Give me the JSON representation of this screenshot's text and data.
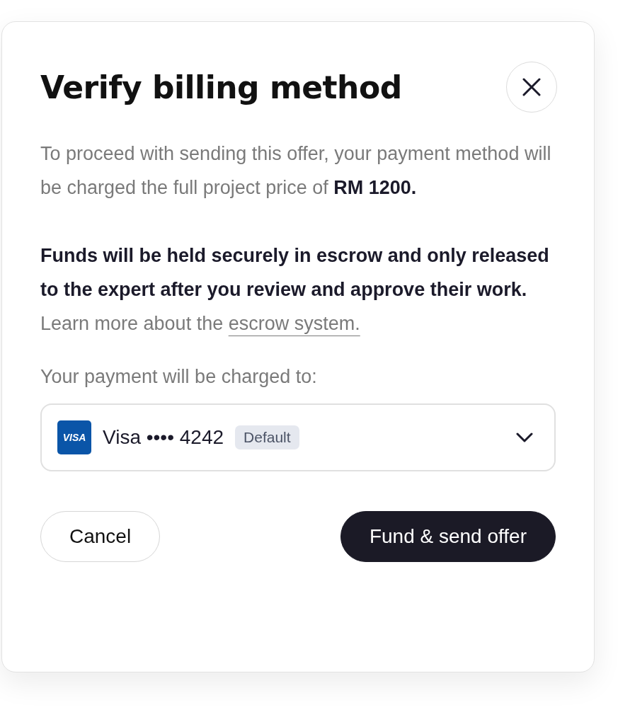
{
  "dialog": {
    "title": "Verify billing method",
    "paragraphs": [
      "To proceed with sending this offer, your payment method will be charged the full project price of **RM 1200.**",
      "**Funds will be held securely in escrow and only released to the expert after you review and approve their work.** Learn more about the"
    ],
    "link": "escrow system.",
    "payment_label": "Your payment will be charged to:",
    "payment_method": {
      "logo": "VISA",
      "label": "Visa •••• 4242",
      "badge": "Default"
    },
    "buttons": [
      {
        "label": "Cancel",
        "kind": "secondary"
      },
      {
        "label": "Fund & send offer",
        "kind": "primary"
      }
    ]
  }
}
